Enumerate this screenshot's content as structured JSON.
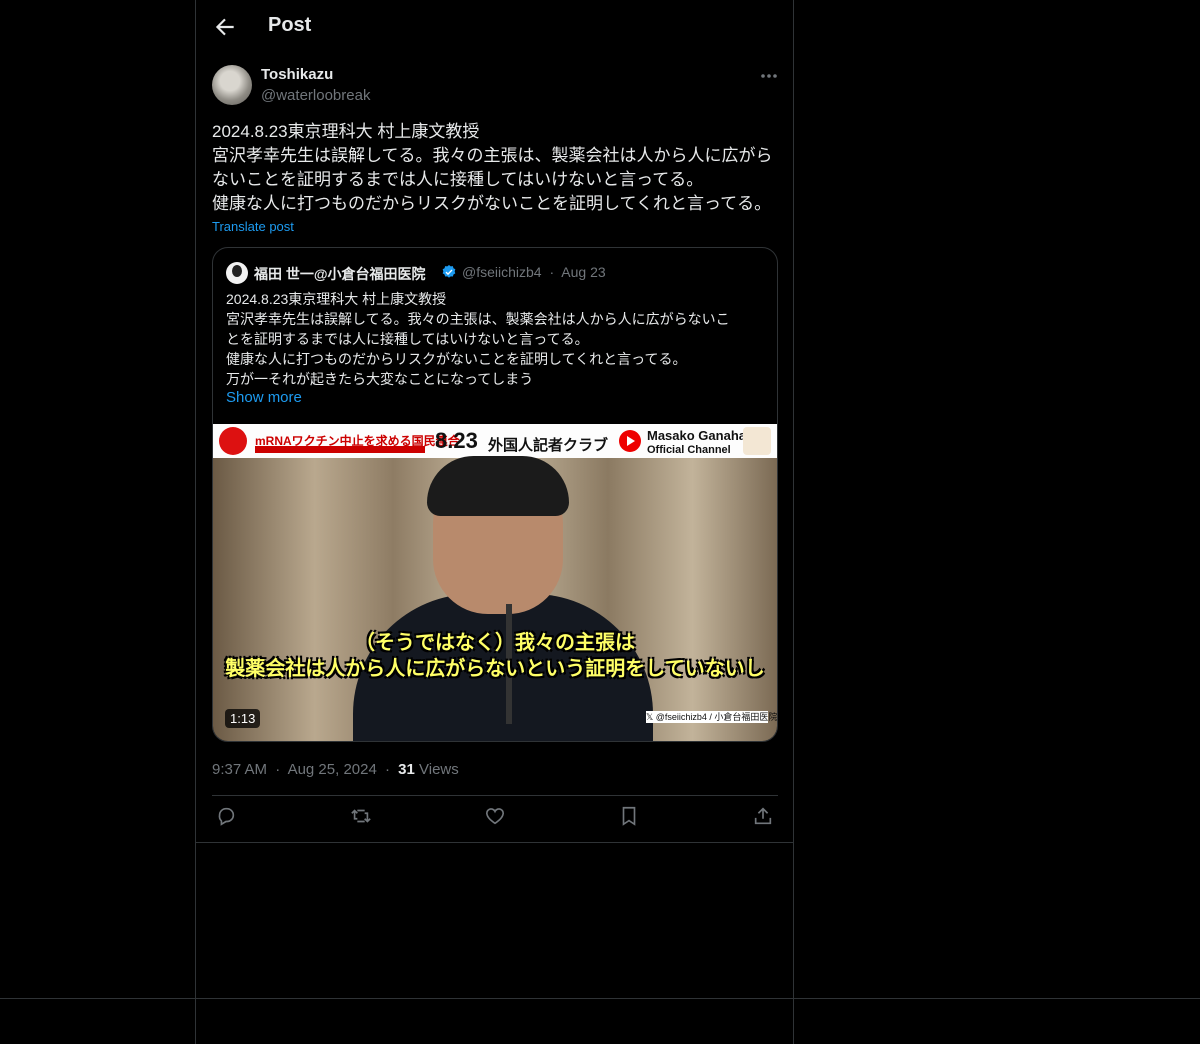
{
  "header": {
    "title": "Post"
  },
  "author": {
    "name": "Toshikazu",
    "handle": "@waterloobreak"
  },
  "tweet": {
    "lines": [
      "2024.8.23東京理科大 村上康文教授",
      "宮沢孝幸先生は誤解してる。我々の主張は、製薬会社は人から人に広がら",
      "ないことを証明するまでは人に接種してはいけないと言ってる。",
      "健康な人に打つものだからリスクがないことを証明してくれと言ってる。"
    ],
    "translate_label": "Translate post"
  },
  "quote": {
    "name": "福田 世一@小倉台福田医院",
    "handle": "@fseiichizb4",
    "separator": "·",
    "date": "Aug 23",
    "lines": [
      "2024.8.23東京理科大 村上康文教授",
      "宮沢孝幸先生は誤解してる。我々の主張は、製薬会社は人から人に広がらないこ",
      "とを証明するまでは人に接種してはいけないと言ってる。",
      "健康な人に打つものだからリスクがないことを証明してくれと言ってる。",
      "万が一それが起きたら大変なことになってしまう"
    ],
    "show_more": "Show more",
    "video": {
      "banner_org": "mRNAワクチン中止を求める国民連合",
      "banner_date": "8.23",
      "banner_club": "外国人記者クラブ",
      "channel_name": "Masako Ganaha",
      "channel_sub": "Official Channel",
      "subtitle_line1": "（そうではなく）我々の主張は",
      "subtitle_line2": "製薬会社は人から人に広がらないという証明をしていないし",
      "watermark": "𝕏 @fseiichizb4 / 小倉台福田医院",
      "duration": "1:13"
    }
  },
  "meta": {
    "time": "9:37 AM",
    "sep": "·",
    "date": "Aug 25, 2024",
    "views_count": "31",
    "views_label": "Views"
  },
  "icons": {
    "back": "back-arrow-icon",
    "more": "more-icon",
    "verified": "verified-badge-icon",
    "reply": "reply-icon",
    "repost": "repost-icon",
    "like": "like-icon",
    "bookmark": "bookmark-icon",
    "share": "share-icon"
  },
  "colors": {
    "accent": "#1d9bf0",
    "muted": "#71767b",
    "border": "#2f3336",
    "text": "#e7e9ea"
  }
}
